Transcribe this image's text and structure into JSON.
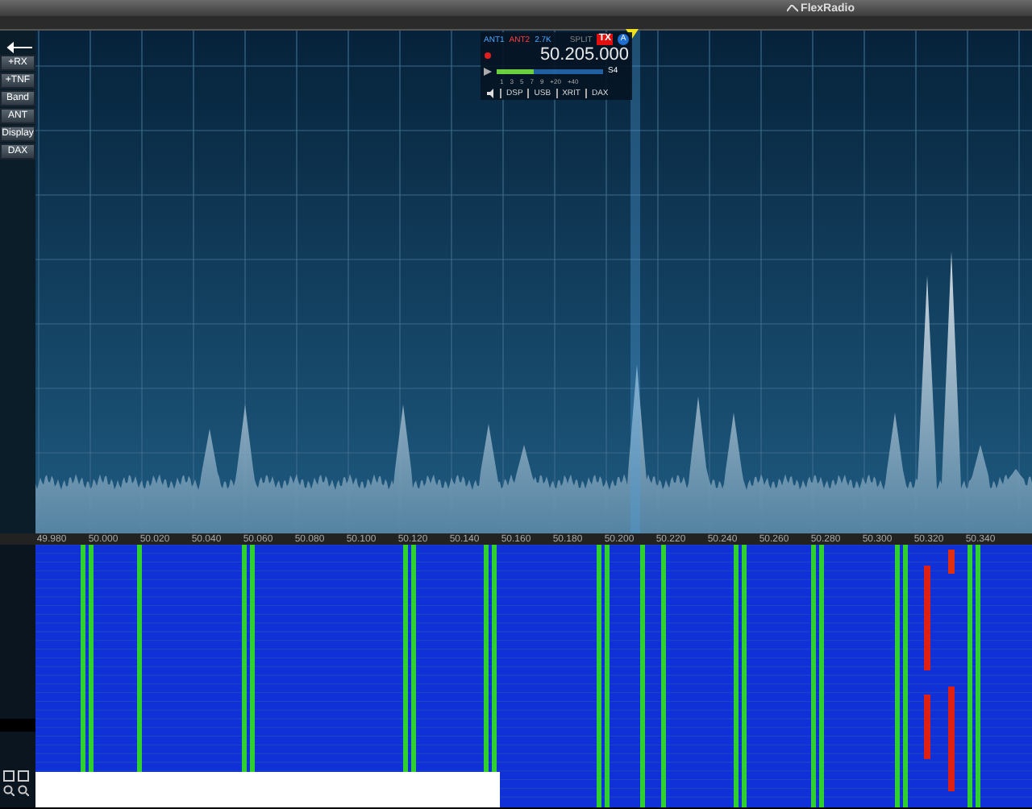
{
  "title_bar": {
    "brand": "FlexRadio"
  },
  "sidebar": {
    "buttons": [
      "+RX",
      "+TNF",
      "Band",
      "ANT",
      "Display",
      "DAX"
    ]
  },
  "slice": {
    "antennas": [
      "ANT1",
      "ANT2"
    ],
    "filter": "2.7K",
    "split": "SPLIT",
    "tx": "TX",
    "letter": "A",
    "frequency": "50.205.000",
    "s_reading": "S4",
    "level": 0.35,
    "meter_scale": [
      "1",
      "3",
      "5",
      "7",
      "9",
      "+20",
      "+40"
    ],
    "tabs": [
      "DSP",
      "USB",
      "XRIT",
      "DAX"
    ]
  },
  "frequency_axis": {
    "labels": [
      "49.980",
      "50.000",
      "50.020",
      "50.040",
      "50.060",
      "50.080",
      "50.100",
      "50.120",
      "50.140",
      "50.160",
      "50.180",
      "50.200",
      "50.220",
      "50.240",
      "50.260",
      "50.280",
      "50.300",
      "50.320",
      "50.340"
    ]
  }
}
